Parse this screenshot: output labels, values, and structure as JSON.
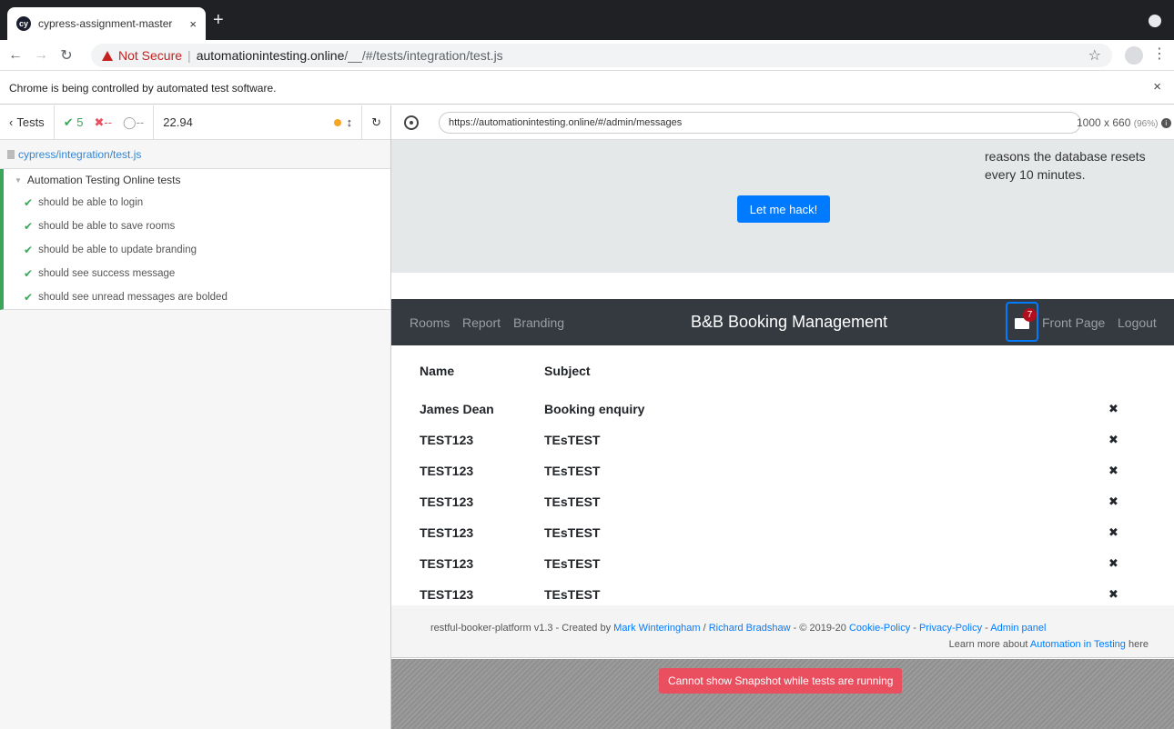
{
  "browser": {
    "tab_title": "cypress-assignment-master",
    "tab_close": "×",
    "new_tab": "+",
    "favicon": "cy",
    "not_secure": "Not Secure",
    "url_separator": "|",
    "url_host": "automationintesting.online",
    "url_path": "/__/#/tests/integration/test.js",
    "infobar_text": "Chrome is being controlled by automated test software.",
    "infobar_close": "×",
    "icons": [
      "back-icon",
      "forward-icon",
      "reload-icon",
      "star-icon",
      "account-icon",
      "menu-icon"
    ]
  },
  "reporter": {
    "tests_label": "Tests",
    "passed_count": "5",
    "failed_count": "--",
    "pending_count": "--",
    "duration": "22.94",
    "spec_file": "cypress/integration/test.js",
    "suite_title": "Automation Testing Online tests",
    "tests": [
      "should be able to login",
      "should be able to save rooms",
      "should be able to update branding",
      "should see success message",
      "should see unread messages are bolded"
    ],
    "colors": {
      "pass": "#3ba559",
      "fail": "#e94f5f",
      "running": "#f5a623"
    }
  },
  "aut": {
    "url": "https://automationintesting.online/#/admin/messages",
    "viewport": "1000 x 660",
    "scale": "(96%)",
    "snapshot_message": "Cannot show Snapshot while tests are running"
  },
  "page": {
    "hack_text": "reasons the database resets every 10 minutes.",
    "hack_button": "Let me hack!",
    "nav": {
      "rooms": "Rooms",
      "report": "Report",
      "branding": "Branding",
      "brand": "B&B Booking Management",
      "unread_count": "7",
      "front_page": "Front Page",
      "logout": "Logout"
    },
    "table": {
      "headers": {
        "name": "Name",
        "subject": "Subject"
      },
      "rows": [
        {
          "name": "James Dean",
          "subject": "Booking enquiry"
        },
        {
          "name": "TEST123",
          "subject": "TEsTEST"
        },
        {
          "name": "TEST123",
          "subject": "TEsTEST"
        },
        {
          "name": "TEST123",
          "subject": "TEsTEST"
        },
        {
          "name": "TEST123",
          "subject": "TEsTEST"
        },
        {
          "name": "TEST123",
          "subject": "TEsTEST"
        },
        {
          "name": "TEST123",
          "subject": "TEsTEST"
        }
      ],
      "delete_glyph": "✖"
    },
    "footer": {
      "prefix": "restful-booker-platform v1.3 - Created by",
      "author1": "Mark Winteringham",
      "slash": "/",
      "author2": "Richard Bradshaw",
      "copyright": "- © 2019-20",
      "cookie": "Cookie-Policy",
      "dash1": "-",
      "privacy": "Privacy-Policy",
      "dash2": "-",
      "admin": "Admin panel",
      "learn_prefix": "Learn more about",
      "learn_link": "Automation in Testing",
      "learn_suffix": "here"
    },
    "colors": {
      "primary": "#007bff",
      "navbar": "#343a40",
      "badge": "#b20e1c"
    }
  }
}
